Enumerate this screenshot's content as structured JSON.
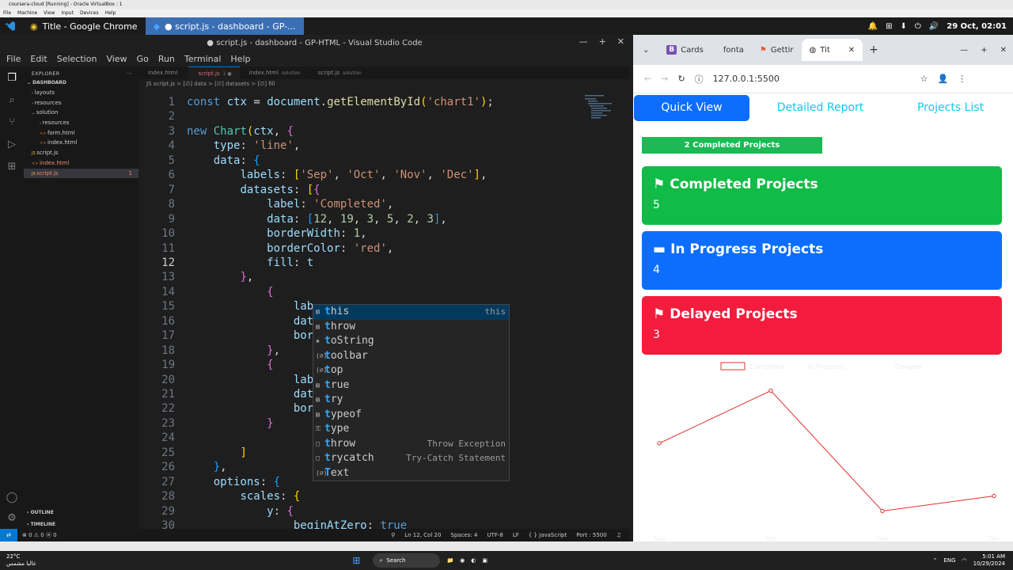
{
  "virtualbox": {
    "title": "coursera-cloud [Running] - Oracle VirtualBox : 1",
    "menu": [
      "File",
      "Machine",
      "View",
      "Input",
      "Devices",
      "Help"
    ]
  },
  "guest_taskbar": {
    "tasks": [
      {
        "label": "Title - Google Chrome",
        "icon": "chrome-icon",
        "active": false
      },
      {
        "label": "● script.js - dashboard - GP-...",
        "icon": "vscode-icon",
        "active": true
      }
    ],
    "datetime": "29 Oct, 02:01"
  },
  "vscode": {
    "title": "● script.js - dashboard - GP-HTML - Visual Studio Code",
    "menu": [
      "File",
      "Edit",
      "Selection",
      "View",
      "Go",
      "Run",
      "Terminal",
      "Help"
    ],
    "explorer": {
      "header": "EXPLORER",
      "root": "DASHBOARD",
      "items": [
        {
          "label": "layouts",
          "indent": 1,
          "type": "folder"
        },
        {
          "label": "resources",
          "indent": 1,
          "type": "folder"
        },
        {
          "label": "solution",
          "indent": 1,
          "type": "folder-open"
        },
        {
          "label": "resources",
          "indent": 2,
          "type": "folder"
        },
        {
          "label": "form.html",
          "indent": 2,
          "type": "html"
        },
        {
          "label": "index.html",
          "indent": 2,
          "type": "html"
        },
        {
          "label": "script.js",
          "indent": 1,
          "type": "js"
        },
        {
          "label": "index.html",
          "indent": 1,
          "type": "html"
        },
        {
          "label": "script.js",
          "indent": 1,
          "type": "js",
          "selected": true,
          "badge": "1"
        }
      ],
      "outline": "OUTLINE",
      "timeline": "TIMELINE"
    },
    "tabs": [
      {
        "label": "index.html",
        "sub": ""
      },
      {
        "label": "script.js",
        "sub": "1 ●",
        "active": true
      },
      {
        "label": "index.html",
        "sub": "solution"
      },
      {
        "label": "script.js",
        "sub": "solution"
      }
    ],
    "breadcrumbs": "JS script.js > [∅] data > [∅] datasets > [∅] fill",
    "current_line": 12,
    "lines": [
      {
        "n": "1",
        "html": "<span class=\"kw\">const</span> <span class=\"vr\">ctx</span> = <span class=\"vr\">document</span>.<span class=\"fn\">getElementById</span><span class=\"br1\">(</span><span class=\"st\">'chart1'</span><span class=\"br1\">)</span>;"
      },
      {
        "n": "2",
        "html": ""
      },
      {
        "n": "3",
        "html": "<span class=\"kw\">new</span> <span class=\"cl\">Chart</span><span class=\"br1\">(</span><span class=\"vr\">ctx</span>, <span class=\"br2\">{</span>"
      },
      {
        "n": "4",
        "html": "    <span class=\"vr\">type</span>: <span class=\"st\">'line'</span>,"
      },
      {
        "n": "5",
        "html": "    <span class=\"vr\">data</span>: <span class=\"br3\">{</span>"
      },
      {
        "n": "6",
        "html": "        <span class=\"vr\">labels</span>: <span class=\"br1\">[</span><span class=\"st\">'Sep'</span>, <span class=\"st\">'Oct'</span>, <span class=\"st\">'Nov'</span>, <span class=\"st\">'Dec'</span><span class=\"br1\">]</span>,"
      },
      {
        "n": "7",
        "html": "        <span class=\"vr\">datasets</span>: <span class=\"br1\">[</span><span class=\"br2\">{</span>"
      },
      {
        "n": "8",
        "html": "            <span class=\"vr\">label</span>: <span class=\"st\">'Completed'</span>,"
      },
      {
        "n": "9",
        "html": "            <span class=\"vr\">data</span>: <span class=\"br3\">[</span><span class=\"nm\">12</span>, <span class=\"nm\">19</span>, <span class=\"nm\">3</span>, <span class=\"nm\">5</span>, <span class=\"nm\">2</span>, <span class=\"nm\">3</span><span class=\"br3\">]</span>,"
      },
      {
        "n": "10",
        "html": "            <span class=\"vr\">borderWidth</span>: <span class=\"nm\">1</span>,"
      },
      {
        "n": "11",
        "html": "            <span class=\"vr\">borderColor</span>: <span class=\"st\">'red'</span>,"
      },
      {
        "n": "12",
        "html": "            <span class=\"vr\">fill</span>: <span class=\"vr\">t</span>"
      },
      {
        "n": "13",
        "html": "        <span class=\"br2\">}</span>,"
      },
      {
        "n": "14",
        "html": "            <span class=\"br2\">{</span>"
      },
      {
        "n": "15",
        "html": "                <span class=\"vr\">lab</span>"
      },
      {
        "n": "16",
        "html": "                <span class=\"vr\">dat</span>"
      },
      {
        "n": "17",
        "html": "                <span class=\"vr\">bor</span>"
      },
      {
        "n": "18",
        "html": "            <span class=\"br2\">}</span>,"
      },
      {
        "n": "19",
        "html": "            <span class=\"br2\">{</span>"
      },
      {
        "n": "20",
        "html": "                <span class=\"vr\">lab</span>"
      },
      {
        "n": "21",
        "html": "                <span class=\"vr\">dat</span>"
      },
      {
        "n": "22",
        "html": "                <span class=\"vr\">bor</span>"
      },
      {
        "n": "23",
        "html": "            <span class=\"br2\">}</span>"
      },
      {
        "n": "24",
        "html": ""
      },
      {
        "n": "25",
        "html": "        <span class=\"br1\">]</span>"
      },
      {
        "n": "26",
        "html": "    <span class=\"br3\">}</span>,"
      },
      {
        "n": "27",
        "html": "    <span class=\"vr\">options</span>: <span class=\"br3\">{</span>"
      },
      {
        "n": "28",
        "html": "        <span class=\"vr\">scales</span>: <span class=\"br1\">{</span>"
      },
      {
        "n": "29",
        "html": "            <span class=\"vr\">y</span>: <span class=\"br2\">{</span>"
      },
      {
        "n": "30",
        "html": "                <span class=\"vr\">beginAtZero</span>: <span class=\"kw\">true</span>"
      }
    ],
    "suggestions": [
      {
        "label": "this",
        "icon": "keyword-icon",
        "detail": "this",
        "selected": true
      },
      {
        "label": "throw",
        "icon": "keyword-icon",
        "detail": ""
      },
      {
        "label": "toString",
        "icon": "method-icon",
        "detail": ""
      },
      {
        "label": "toolbar",
        "icon": "variable-icon",
        "detail": ""
      },
      {
        "label": "top",
        "icon": "variable-icon",
        "detail": ""
      },
      {
        "label": "true",
        "icon": "keyword-icon",
        "detail": ""
      },
      {
        "label": "try",
        "icon": "keyword-icon",
        "detail": ""
      },
      {
        "label": "typeof",
        "icon": "keyword-icon",
        "detail": ""
      },
      {
        "label": "type",
        "icon": "property-icon",
        "detail": ""
      },
      {
        "label": "throw",
        "icon": "snippet-icon",
        "detail": "Throw Exception"
      },
      {
        "label": "trycatch",
        "icon": "snippet-icon",
        "detail": "Try-Catch Statement"
      },
      {
        "label": "Text",
        "icon": "variable-icon",
        "detail": ""
      }
    ],
    "status": {
      "left": "⊗ 0 ⚠ 0   ⓦ 0",
      "position": "Ln 12, Col 20",
      "spaces": "Spaces: 4",
      "encoding": "UTF-8",
      "eol": "LF",
      "language": "{ } JavaScript",
      "port": "Port : 5500"
    }
  },
  "chrome": {
    "tabs": [
      {
        "label": "Cards",
        "icon": "bootstrap-icon"
      },
      {
        "label": "fonta",
        "icon": "flag-icon"
      },
      {
        "label": "Gettir",
        "icon": "fontawesome-icon"
      },
      {
        "label": "Tit",
        "icon": "globe-icon",
        "active": true
      }
    ],
    "url": "127.0.0.1:5500",
    "nav_tabs": [
      "Quick View",
      "Detailed Report",
      "Projects List"
    ],
    "progress_label": "2 Completed Projects",
    "progress_fraction": 0.5,
    "cards": [
      {
        "title": "Completed Projects",
        "value": "5",
        "color": "#11bb47",
        "icon": "flag-checkered-icon"
      },
      {
        "title": "In Progress Projects",
        "value": "4",
        "color": "#0d6efd",
        "icon": "bars-icon"
      },
      {
        "title": "Delayed Projects",
        "value": "3",
        "color": "#f41c3c",
        "icon": "flag-checkered-icon"
      }
    ]
  },
  "chart_data": {
    "type": "line",
    "legend": [
      "Completed",
      "In Progress",
      "Delayed"
    ],
    "legend_position": "top",
    "categories": [
      "Sep",
      "Oct",
      "Nov",
      "Dec"
    ],
    "series": [
      {
        "name": "Completed",
        "values": [
          12,
          19,
          3,
          5
        ],
        "color": "#e03030"
      }
    ],
    "ylim": [
      0,
      20
    ],
    "grid": false
  },
  "windows_taskbar": {
    "weather_temp": "22°C",
    "weather_text": "غالبا مشمس",
    "search": "Search",
    "lang": "ENG",
    "time": "5:01 AM",
    "date": "10/29/2024"
  }
}
